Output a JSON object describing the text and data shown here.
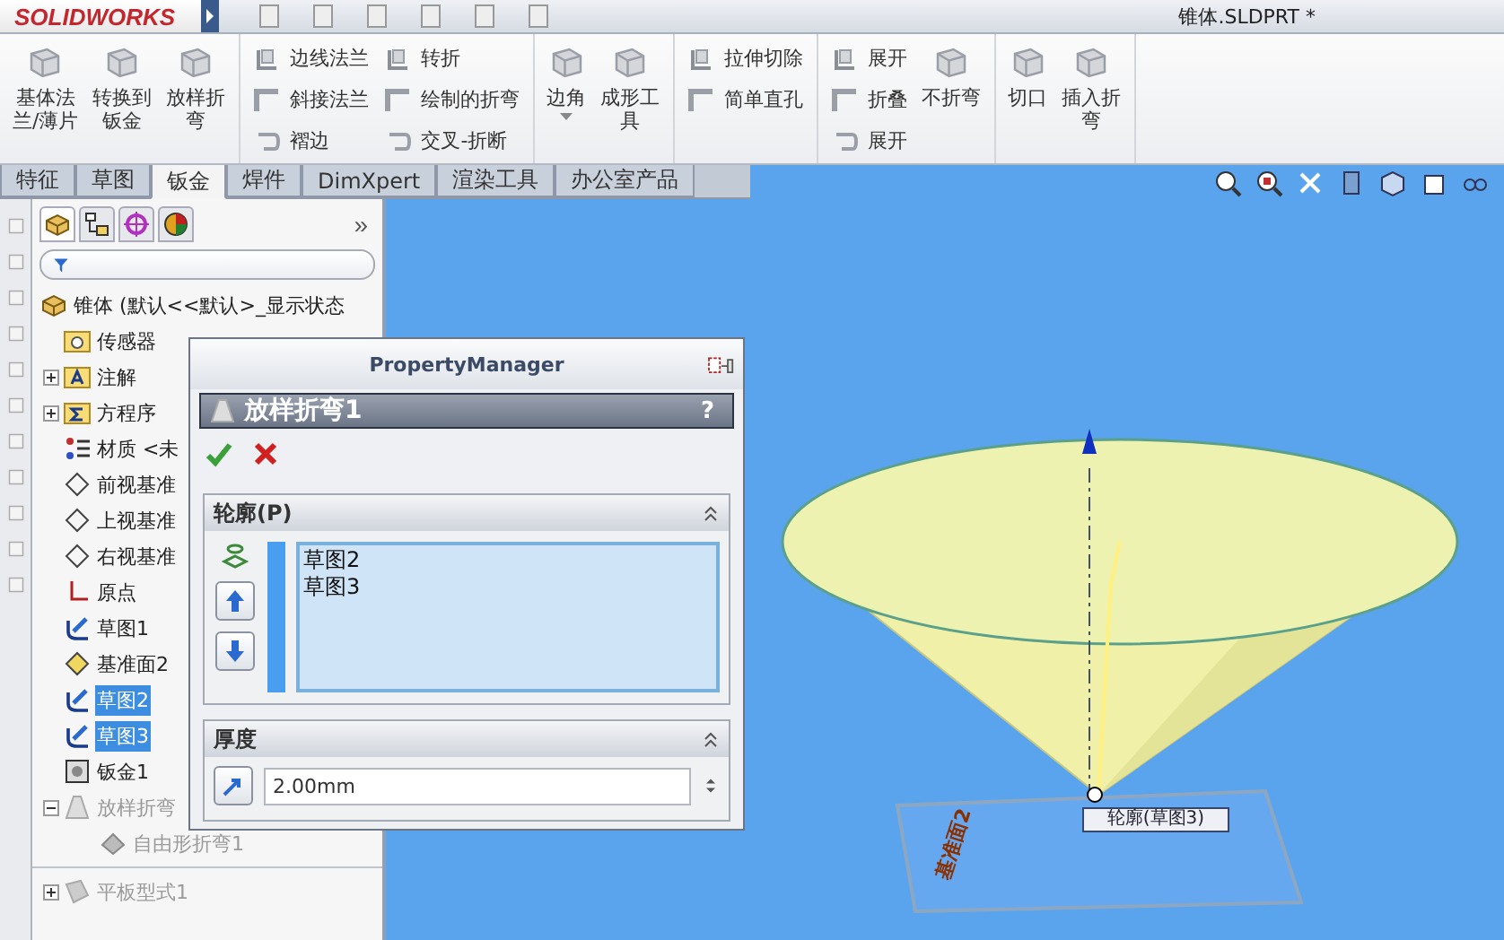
{
  "app": {
    "logo": "SOLIDWORKS",
    "title": "锥体.SLDPRT *"
  },
  "ribbon": {
    "groups": [
      {
        "items": [
          {
            "kind": "large",
            "lines": [
              "基体法",
              "兰/薄片"
            ]
          },
          {
            "kind": "large",
            "lines": [
              "转换到",
              "钣金"
            ]
          },
          {
            "kind": "large",
            "lines": [
              "放样折",
              "弯"
            ]
          }
        ]
      },
      {
        "items": [
          {
            "kind": "stack",
            "labels": [
              "边线法兰",
              "斜接法兰",
              "褶边"
            ]
          },
          {
            "kind": "stack",
            "labels": [
              "转折",
              "绘制的折弯",
              "交叉-折断"
            ]
          }
        ]
      },
      {
        "items": [
          {
            "kind": "large",
            "lines": [
              "边角"
            ],
            "dropdown": true
          },
          {
            "kind": "large",
            "lines": [
              "成形工",
              "具"
            ]
          }
        ]
      },
      {
        "items": [
          {
            "kind": "stack",
            "labels": [
              "拉伸切除",
              "简单直孔"
            ]
          }
        ]
      },
      {
        "items": [
          {
            "kind": "stack",
            "labels": [
              "展开",
              "折叠",
              "展开"
            ]
          },
          {
            "kind": "large",
            "lines": [
              "不折弯"
            ]
          }
        ]
      },
      {
        "items": [
          {
            "kind": "large",
            "lines": [
              "切口"
            ]
          },
          {
            "kind": "large",
            "lines": [
              "插入折",
              "弯"
            ]
          }
        ]
      }
    ]
  },
  "tabs": [
    {
      "label": "特征",
      "selected": false
    },
    {
      "label": "草图",
      "selected": false
    },
    {
      "label": "钣金",
      "selected": true
    },
    {
      "label": "焊件",
      "selected": false
    },
    {
      "label": "DimXpert",
      "selected": false
    },
    {
      "label": "渲染工具",
      "selected": false
    },
    {
      "label": "办公室产品",
      "selected": false
    }
  ],
  "feature_tree": {
    "more": "»",
    "root": {
      "label": "锥体 (默认<<默认>_显示状态",
      "kind": "part",
      "children": [
        {
          "label": "传感器",
          "kind": "sensor",
          "selected": false,
          "disabled": false
        },
        {
          "label": "注解",
          "kind": "annotation",
          "selected": false,
          "disabled": false,
          "expanded": false
        },
        {
          "label": "方程序",
          "kind": "equation",
          "selected": false,
          "disabled": false,
          "expanded": false
        },
        {
          "label": "材质 <未",
          "kind": "material",
          "selected": false,
          "disabled": false
        },
        {
          "label": "前视基准",
          "kind": "plane",
          "selected": false,
          "disabled": false
        },
        {
          "label": "上视基准",
          "kind": "plane",
          "selected": false,
          "disabled": false
        },
        {
          "label": "右视基准",
          "kind": "plane",
          "selected": false,
          "disabled": false
        },
        {
          "label": "原点",
          "kind": "origin",
          "selected": false,
          "disabled": false
        },
        {
          "label": "草图1",
          "kind": "sketch",
          "selected": false,
          "disabled": false
        },
        {
          "label": "基准面2",
          "kind": "refplane",
          "selected": false,
          "disabled": false
        },
        {
          "label": "草图2",
          "kind": "sketch",
          "selected": true,
          "disabled": false
        },
        {
          "label": "草图3",
          "kind": "sketch",
          "selected": true,
          "disabled": false
        },
        {
          "label": "钣金1",
          "kind": "sheetmetal",
          "selected": false,
          "disabled": false
        },
        {
          "label": "放样折弯",
          "kind": "loft",
          "selected": false,
          "disabled": true,
          "expanded": true,
          "children": [
            {
              "label": "自由形折弯1",
              "kind": "bend",
              "selected": false,
              "disabled": true
            }
          ]
        }
      ]
    },
    "after": [
      {
        "label": "平板型式1",
        "kind": "flat",
        "selected": false,
        "disabled": true,
        "expanded": false
      }
    ]
  },
  "property_manager": {
    "header": "PropertyManager",
    "title": "放样折弯1",
    "help": "?",
    "sections": [
      {
        "kind": "list",
        "title": "轮廓(P)",
        "expanded": true,
        "items": [
          "草图2",
          "草图3"
        ]
      },
      {
        "kind": "number",
        "title": "厚度",
        "expanded": true,
        "value": "2.00mm"
      }
    ]
  },
  "viewport": {
    "callout": "轮廓(草图3)",
    "plane_label": "基准面2"
  }
}
